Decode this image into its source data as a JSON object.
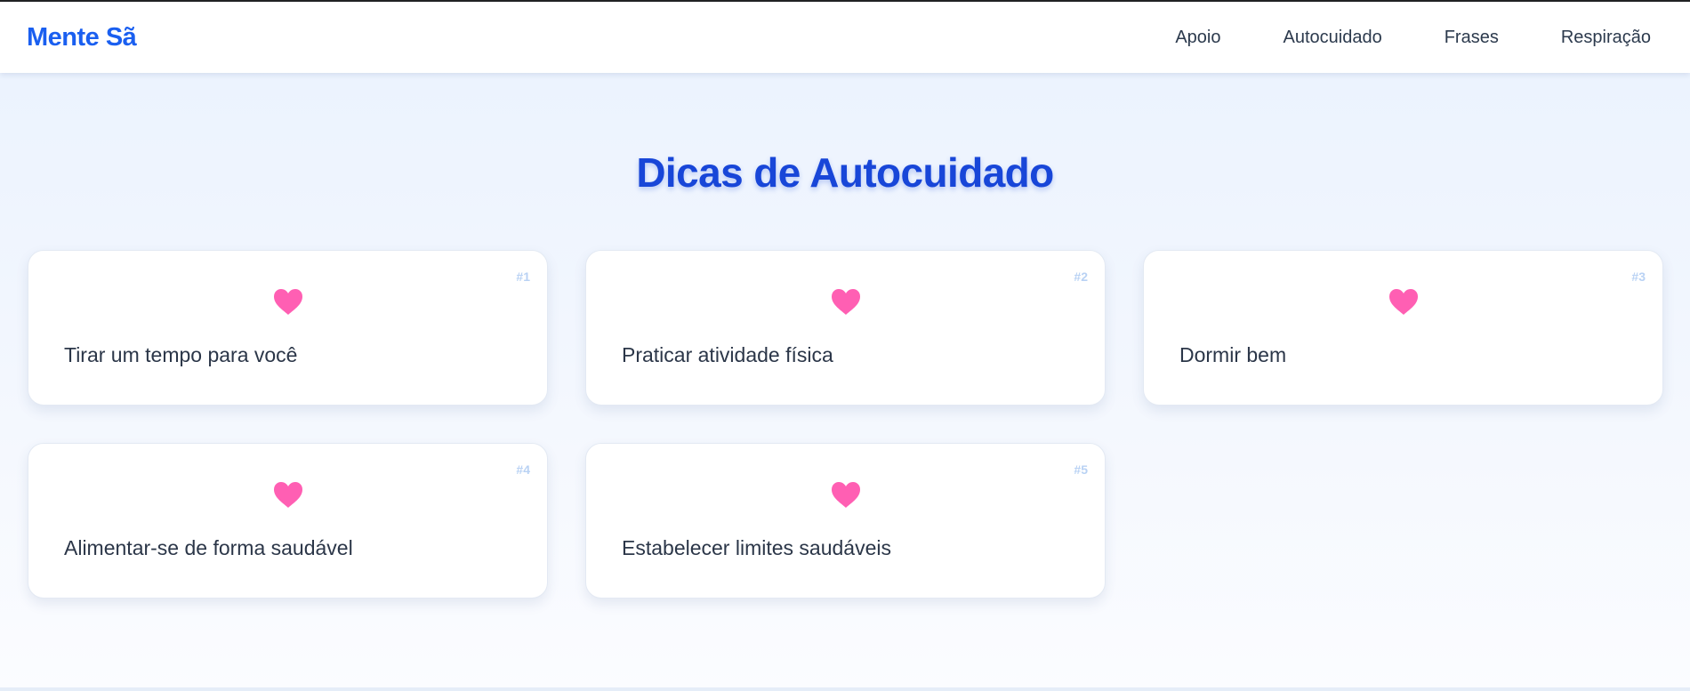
{
  "header": {
    "logo": "Mente Sã",
    "nav": [
      {
        "label": "Apoio"
      },
      {
        "label": "Autocuidado"
      },
      {
        "label": "Frases"
      },
      {
        "label": "Respiração"
      }
    ]
  },
  "main": {
    "title": "Dicas de Autocuidado",
    "cards": [
      {
        "number": "#1",
        "text": "Tirar um tempo para você",
        "icon": "heart-icon"
      },
      {
        "number": "#2",
        "text": "Praticar atividade física",
        "icon": "heart-icon"
      },
      {
        "number": "#3",
        "text": "Dormir bem",
        "icon": "heart-icon"
      },
      {
        "number": "#4",
        "text": "Alimentar-se de forma saudável",
        "icon": "heart-icon"
      },
      {
        "number": "#5",
        "text": "Estabelecer limites saudáveis",
        "icon": "heart-icon"
      }
    ]
  },
  "colors": {
    "brand": "#1a5ff0",
    "title": "#1846d8",
    "heart": "#ff5fb3",
    "card_number": "#b9d2f4"
  }
}
